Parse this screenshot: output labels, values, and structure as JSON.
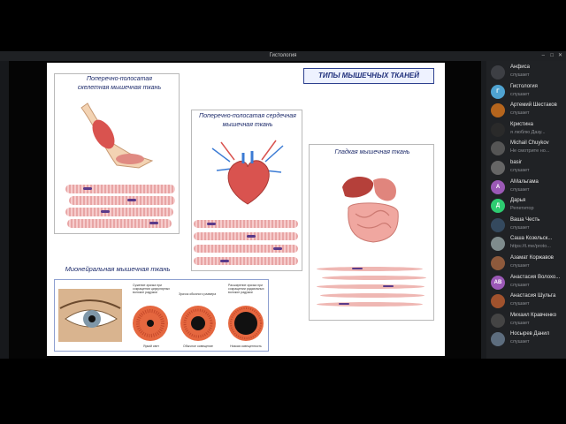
{
  "window": {
    "title": "Гистология"
  },
  "slide": {
    "main_title": "ТИПЫ МЫШЕЧНЫХ ТКАНЕЙ",
    "skeletal_title": "Поперечно-полосатая скелетная мышечная ткань",
    "cardiac_title": "Поперечно-полосатая сердечная мышечная ткань",
    "smooth_title": "Гладкая мышечная ткань",
    "myoneural_title": "Мионейральная мышечная ткань",
    "iris_labels": [
      "Сужение зрачка при сокращении циркулярных волокон радужки",
      "Зрачок обычного размера",
      "Расширение зрачка при сокращении радиальных волокон радужки"
    ],
    "iris_captions": [
      "Яркий свет",
      "Обычное освещение",
      "Низкая освещенность"
    ]
  },
  "participants": [
    {
      "name": "Анфиса",
      "status": "слушает",
      "avatar_color": "#3d3f44",
      "initial": ""
    },
    {
      "name": "Гистология",
      "status": "слушает",
      "avatar_color": "#4fa3d1",
      "initial": "Г"
    },
    {
      "name": "Артемий Шестаков",
      "status": "слушает",
      "avatar_color": "#b5651d",
      "initial": ""
    },
    {
      "name": "Кристина",
      "status": "я люблю Дазу...",
      "avatar_color": "#2a2a2a",
      "initial": ""
    },
    {
      "name": "Michail Chuykov",
      "status": "Не смотрите но...",
      "avatar_color": "#555555",
      "initial": ""
    },
    {
      "name": "basir",
      "status": "слушает",
      "avatar_color": "#666666",
      "initial": ""
    },
    {
      "name": "АМальгама",
      "status": "слушает",
      "avatar_color": "#9b59b6",
      "initial": "А"
    },
    {
      "name": "Дарья",
      "status": "Репетитор",
      "avatar_color": "#2ecc71",
      "initial": "Д"
    },
    {
      "name": "Ваша Честь",
      "status": "слушает",
      "avatar_color": "#34495e",
      "initial": ""
    },
    {
      "name": "Саша Козельск...",
      "status": "https://t.me/proto...",
      "avatar_color": "#7f8c8d",
      "initial": ""
    },
    {
      "name": "Азамат Коржавов",
      "status": "слушает",
      "avatar_color": "#8e5a3c",
      "initial": ""
    },
    {
      "name": "Анастасия Волохо...",
      "status": "слушает",
      "avatar_color": "#9b59b6",
      "initial": "АВ"
    },
    {
      "name": "Анастасия Шульга",
      "status": "слушает",
      "avatar_color": "#a0522d",
      "initial": ""
    },
    {
      "name": "Михаил Кравченко",
      "status": "слушает",
      "avatar_color": "#444444",
      "initial": ""
    },
    {
      "name": "Носырев Данил",
      "status": "слушает",
      "avatar_color": "#5d6d7e",
      "initial": ""
    }
  ]
}
